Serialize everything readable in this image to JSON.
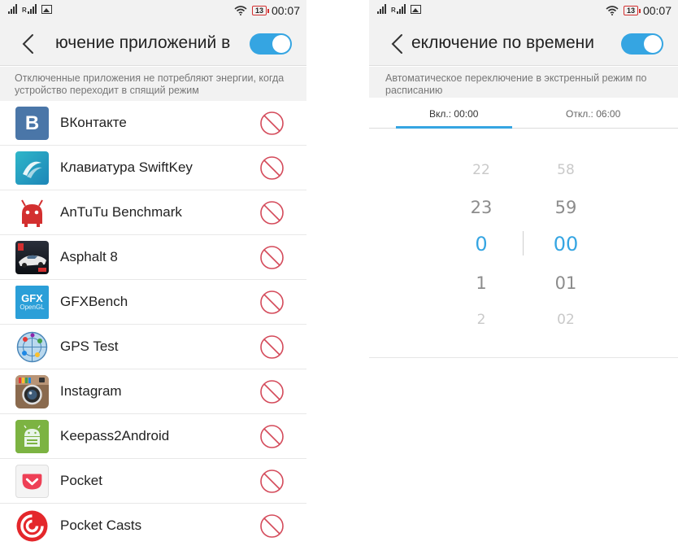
{
  "status_bar": {
    "time": "00:07",
    "battery": "13"
  },
  "left_screen": {
    "title": "ючение приложений в",
    "description": "Отключенные приложения не потребляют энергии, когда устройство переходит в спящий режим",
    "toggle_on": true,
    "apps": [
      {
        "name": "ВКонтакте",
        "icon": "vk-icon"
      },
      {
        "name": "Клавиатура SwiftKey",
        "icon": "swiftkey-icon"
      },
      {
        "name": "AnTuTu Benchmark",
        "icon": "antutu-icon"
      },
      {
        "name": "Asphalt 8",
        "icon": "asphalt-icon"
      },
      {
        "name": "GFXBench",
        "icon": "gfxbench-icon"
      },
      {
        "name": "GPS Test",
        "icon": "gps-test-icon"
      },
      {
        "name": "Instagram",
        "icon": "instagram-icon"
      },
      {
        "name": "Keepass2Android",
        "icon": "keepass-icon"
      },
      {
        "name": "Pocket",
        "icon": "pocket-icon"
      },
      {
        "name": "Pocket Casts",
        "icon": "pocket-casts-icon"
      }
    ],
    "gfx_icon_text": {
      "main": "GFX",
      "sub": "OpenGL"
    },
    "vk_icon_text": "В"
  },
  "right_screen": {
    "title": "еключение по времени",
    "description": "Автоматическое переключение в экстренный режим по расписанию",
    "toggle_on": true,
    "tabs": {
      "on": "Вкл.: 00:00",
      "off": "Откл.: 06:00"
    },
    "hours": [
      "22",
      "23",
      "0",
      "1",
      "2"
    ],
    "minutes": [
      "58",
      "59",
      "00",
      "01",
      "02"
    ],
    "selected_index": 2
  },
  "colors": {
    "accent": "#35a5e2",
    "block": "#d44a5a",
    "header_bg": "#f2f2f2"
  }
}
